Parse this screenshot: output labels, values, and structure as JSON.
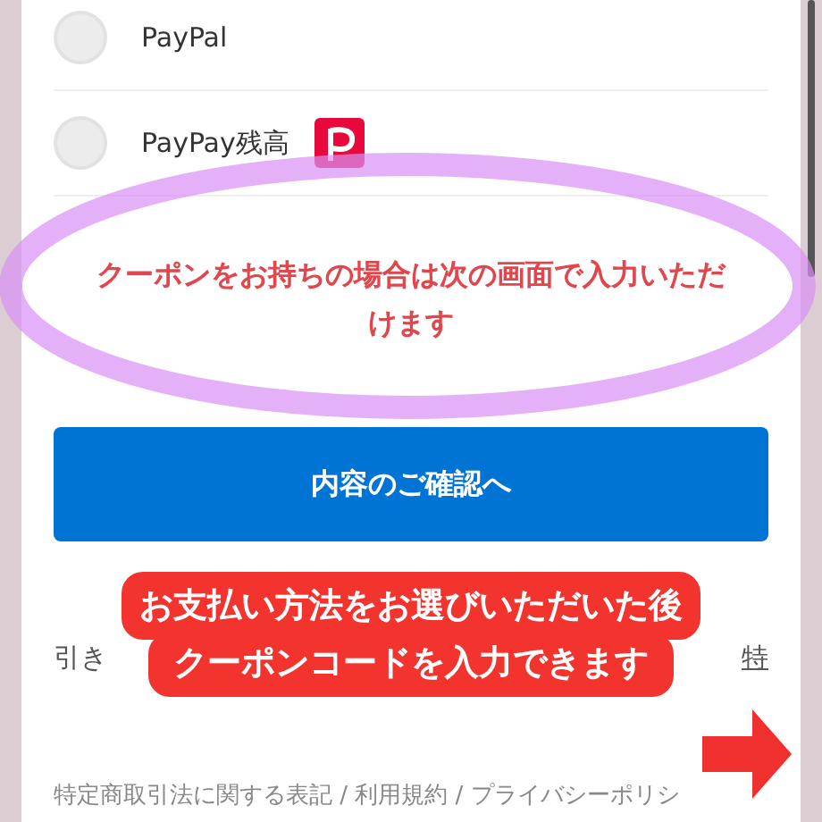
{
  "payment_methods": [
    {
      "label": "PayPal",
      "selected": false,
      "kind": "plain"
    },
    {
      "label": "PayPay残高",
      "selected": false,
      "kind": "paypay"
    }
  ],
  "coupon_note": "クーポンをお持ちの場合は次の画面で入力いただけます",
  "confirm_button": "内容のご確認へ",
  "legal_text": {
    "start": "引き",
    "end_link": "特"
  },
  "footer": "特定商取引法に関する表記 / 利用規約 / プライバシーポリシ",
  "annotation": {
    "lines": [
      "お支払い方法をお選びいただいた後",
      "クーポンコードを入力できます"
    ]
  }
}
